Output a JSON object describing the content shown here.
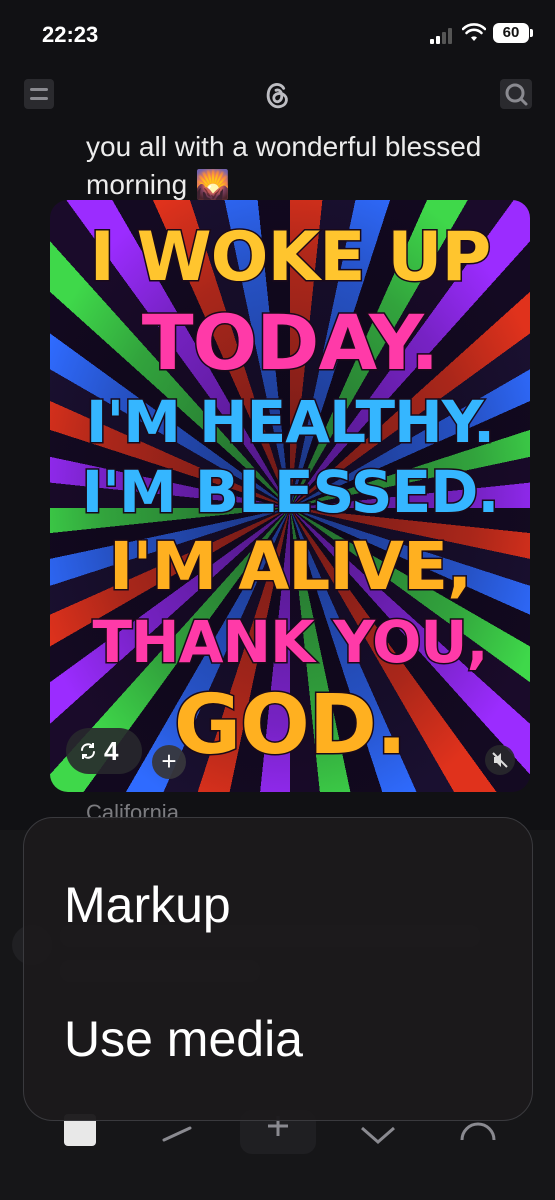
{
  "status_bar": {
    "time": "22:23",
    "battery": "60"
  },
  "post": {
    "text": "you all with a wonderful blessed morning 🌄",
    "image_lines": [
      "I WOKE UP",
      "TODAY.",
      "I'M HEALTHY.",
      "I'M BLESSED.",
      "I'M ALIVE,",
      "THANK YOU,",
      "GOD."
    ],
    "repost_count": "4",
    "location": "California"
  },
  "context_menu": {
    "items": [
      {
        "label": "Markup"
      },
      {
        "label": "Use media"
      }
    ]
  },
  "colors": {
    "background": "#111114",
    "menu": "#1c1a1c",
    "text": "#ffffff"
  }
}
